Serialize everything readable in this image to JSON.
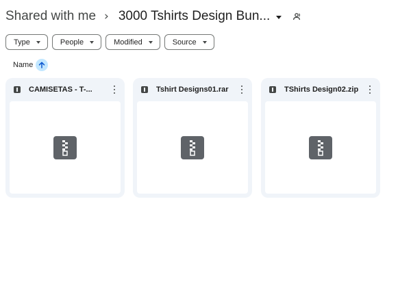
{
  "breadcrumb": {
    "root": "Shared with me",
    "separator": "›",
    "current": "3000 Tshirts Design Bun..."
  },
  "filters": [
    "Type",
    "People",
    "Modified",
    "Source"
  ],
  "sort": {
    "label": "Name",
    "direction": "ascending"
  },
  "files": [
    {
      "name": "CAMISETAS - T-...",
      "kind": "zip-archive"
    },
    {
      "name": "Tshirt Designs01.rar",
      "kind": "zip-archive"
    },
    {
      "name": "TShirts Design02.zip",
      "kind": "zip-archive"
    }
  ],
  "colors": {
    "card_bg": "#f0f4f9",
    "accent": "#c2e7ff",
    "icon": "#5f6368"
  },
  "icons": {
    "share": "shared-folder-icon",
    "sort": "arrow-up-icon",
    "file": "archive-file-icon",
    "more": "more-vert-icon"
  }
}
